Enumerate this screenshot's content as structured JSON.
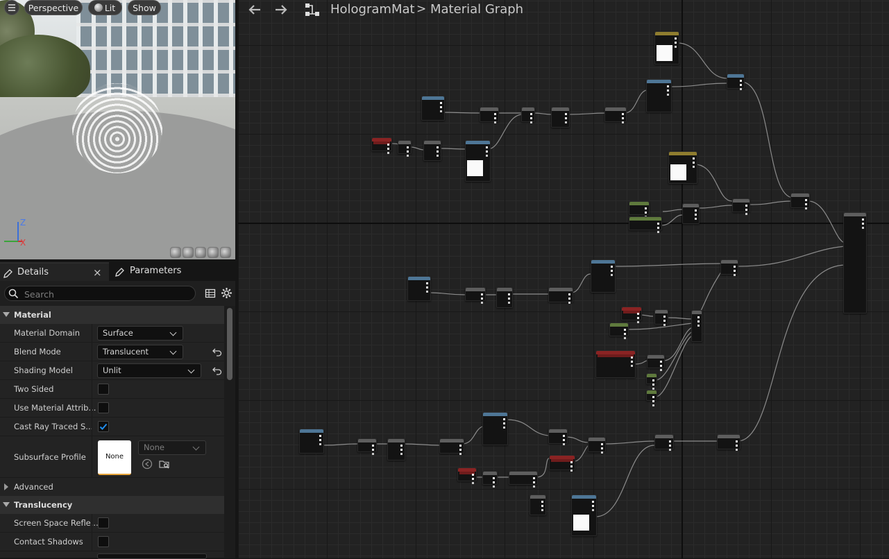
{
  "viewport": {
    "menu_icon": "hamburger-icon",
    "perspective_label": "Perspective",
    "lit_label": "Lit",
    "show_label": "Show",
    "axis_z": "Z",
    "axis_x": "X"
  },
  "details": {
    "tabs": [
      {
        "label": "Details",
        "icon": "pencil-icon",
        "active": true
      },
      {
        "label": "Parameters",
        "icon": "pencil-icon",
        "active": false
      }
    ],
    "close_glyph": "×",
    "search_placeholder": "Search",
    "sections": {
      "material": "Material",
      "advanced": "Advanced",
      "translucency": "Translucency"
    },
    "props": {
      "material_domain": {
        "label": "Material Domain",
        "value": "Surface"
      },
      "blend_mode": {
        "label": "Blend Mode",
        "value": "Translucent"
      },
      "shading_model": {
        "label": "Shading Model",
        "value": "Unlit"
      },
      "two_sided": {
        "label": "Two Sided",
        "checked": false
      },
      "use_material_attrib": {
        "label": "Use Material Attrib...",
        "checked": false
      },
      "cast_ray_traced": {
        "label": "Cast Ray Traced S...",
        "checked": true
      },
      "subsurface_profile": {
        "label": "Subsurface Profile",
        "thumb": "None",
        "value": "None"
      },
      "screen_space_refl": {
        "label": "Screen Space Refle...",
        "checked": false
      },
      "contact_shadows": {
        "label": "Contact Shadows",
        "checked": false
      }
    },
    "accent_color": "#e8a43a",
    "check_color": "#1f8ded"
  },
  "graph": {
    "breadcrumb_root": "HologramMat",
    "breadcrumb_separator": ">",
    "breadcrumb_leaf": "Material Graph",
    "back_icon": "arrow-left-icon",
    "forward_icon": "arrow-right-icon",
    "graph_icon": "graph-icon"
  }
}
